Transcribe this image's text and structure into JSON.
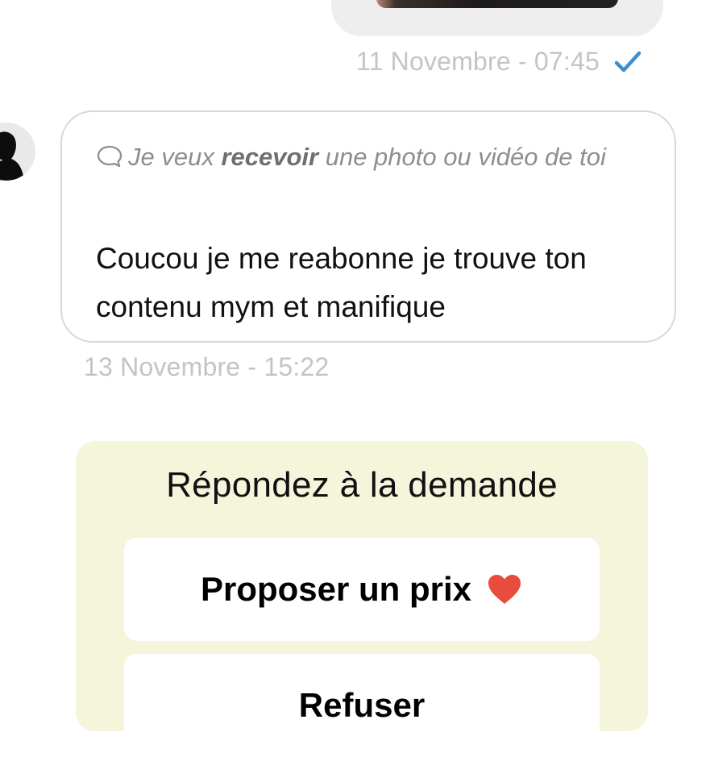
{
  "sent_message": {
    "timestamp": "11 Novembre - 07:45",
    "status_icon": "check-icon",
    "status_color": "#3d8fd4"
  },
  "received_message": {
    "avatar_icon": "user-avatar",
    "request_prefix": "Je veux ",
    "request_action": "recevoir",
    "request_suffix": " une photo ou vidéo de toi",
    "request_icon": "speech-bubble-icon",
    "text": "Coucou je me reabonne je trouve ton contenu mym et manifique",
    "timestamp": "13 Novembre - 15:22"
  },
  "reply_panel": {
    "title": "Répondez à la demande",
    "background_color": "#f5f5dc",
    "propose_button": {
      "label": "Proposer un prix",
      "icon": "heart-icon",
      "icon_color": "#e74c3c"
    },
    "refuse_button": {
      "label": "Refuser"
    }
  }
}
